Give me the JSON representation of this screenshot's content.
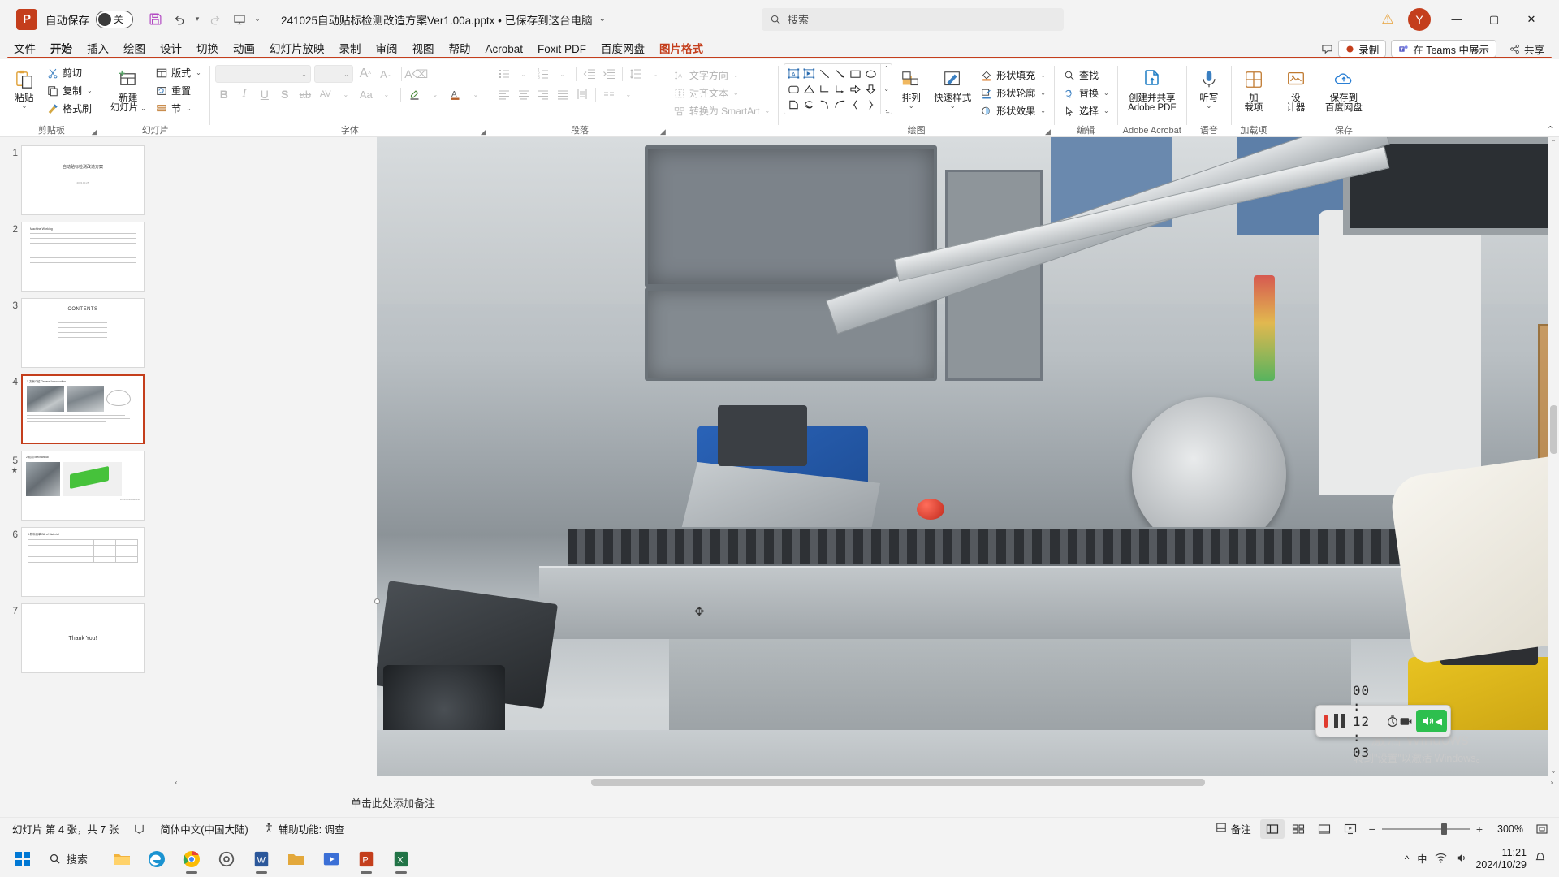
{
  "titlebar": {
    "app_badge": "P",
    "autosave_label": "自动保存",
    "autosave_state": "关",
    "save_icon": "save-icon",
    "undo_icon": "undo-icon",
    "redo_icon": "redo-icon",
    "present_icon": "start-presentation-icon",
    "customize_icon": "customize-quick-access-icon",
    "doc_title": "241025自动贴标检测改造方案Ver1.00a.pptx • 已保存到这台电脑",
    "search_placeholder": "搜索",
    "warning_icon": "warning-icon",
    "avatar_initial": "Y",
    "minimize": "—",
    "maximize": "▢",
    "close": "✕"
  },
  "tabs": [
    {
      "label": "文件",
      "state": "normal"
    },
    {
      "label": "开始",
      "state": "active"
    },
    {
      "label": "插入",
      "state": "normal"
    },
    {
      "label": "绘图",
      "state": "normal"
    },
    {
      "label": "设计",
      "state": "normal"
    },
    {
      "label": "切换",
      "state": "normal"
    },
    {
      "label": "动画",
      "state": "normal"
    },
    {
      "label": "幻灯片放映",
      "state": "normal"
    },
    {
      "label": "录制",
      "state": "normal"
    },
    {
      "label": "审阅",
      "state": "normal"
    },
    {
      "label": "视图",
      "state": "normal"
    },
    {
      "label": "帮助",
      "state": "normal"
    },
    {
      "label": "Acrobat",
      "state": "normal"
    },
    {
      "label": "Foxit PDF",
      "state": "normal"
    },
    {
      "label": "百度网盘",
      "state": "normal"
    },
    {
      "label": "图片格式",
      "state": "contextual"
    }
  ],
  "tabs_right": {
    "comment_icon": "comment-icon",
    "record_label": "录制",
    "record_icon": "record-dot-icon",
    "teams_label": "在 Teams 中展示",
    "teams_icon": "teams-icon",
    "share_label": "共享",
    "share_icon": "share-icon"
  },
  "ribbon": {
    "collapse_icon": "collapse-ribbon-icon",
    "groups": [
      {
        "name": "clipboard",
        "label": "剪贴板",
        "paste": {
          "label": "粘贴",
          "icon": "paste-icon"
        },
        "items": [
          {
            "label": "剪切",
            "icon": "scissors-icon"
          },
          {
            "label": "复制",
            "icon": "copy-icon"
          },
          {
            "label": "格式刷",
            "icon": "format-painter-icon"
          }
        ]
      },
      {
        "name": "slides",
        "label": "幻灯片",
        "newslide": {
          "label": "新建\n幻灯片",
          "icon": "new-slide-icon"
        },
        "items": [
          {
            "label": "版式",
            "icon": "layout-icon"
          },
          {
            "label": "重置",
            "icon": "reset-icon"
          },
          {
            "label": "节",
            "icon": "section-icon"
          }
        ]
      },
      {
        "name": "font",
        "label": "字体",
        "font_name": "",
        "font_size": "",
        "grow_icon": "grow-font-icon",
        "shrink_icon": "shrink-font-icon",
        "clear_format_icon": "clear-formatting-icon",
        "bold": "B",
        "italic": "I",
        "underline": "U",
        "shadow": "S",
        "strike_icon": "strikethrough-icon",
        "char_spacing_icon": "character-spacing-icon",
        "case_icon": "change-case-icon",
        "highlight_icon": "text-highlight-icon",
        "fontcolor_icon": "font-color-icon"
      },
      {
        "name": "paragraph",
        "label": "段落",
        "bullets_icon": "bullets-icon",
        "numbering_icon": "numbering-icon",
        "dec_indent_icon": "decrease-indent-icon",
        "inc_indent_icon": "increase-indent-icon",
        "line_spacing_icon": "line-spacing-icon",
        "align_left_icon": "align-left-icon",
        "align_center_icon": "align-center-icon",
        "align_right_icon": "align-right-icon",
        "justify_icon": "justify-icon",
        "columns_icon": "columns-icon",
        "text_dir_label": "文字方向",
        "text_dir_icon": "text-direction-icon",
        "align_text_label": "对齐文本",
        "align_text_icon": "align-text-icon",
        "smartart_label": "转换为 SmartArt",
        "smartart_icon": "smartart-icon"
      },
      {
        "name": "drawing",
        "label": "绘图",
        "shapes": [
          "textbox",
          "arrow-textbox",
          "line",
          "arrow",
          "rectangle",
          "oval",
          "rounded-rect",
          "triangle",
          "elbow-connector",
          "elbow-arrow",
          "block-arrow",
          "down-arrow",
          "flowchart-shape",
          "scribble",
          "curve",
          "arc",
          "left-brace",
          "right-brace"
        ],
        "arrange_label": "排列",
        "arrange_icon": "arrange-icon",
        "quickstyle_label": "快速样式",
        "quickstyle_icon": "quick-styles-icon",
        "items": [
          {
            "label": "形状填充",
            "icon": "shape-fill-icon"
          },
          {
            "label": "形状轮廓",
            "icon": "shape-outline-icon"
          },
          {
            "label": "形状效果",
            "icon": "shape-effects-icon"
          }
        ]
      },
      {
        "name": "editing",
        "label": "编辑",
        "items": [
          {
            "label": "查找",
            "icon": "search-icon"
          },
          {
            "label": "替换",
            "icon": "replace-icon"
          },
          {
            "label": "选择",
            "icon": "select-icon"
          }
        ]
      },
      {
        "name": "adobe",
        "label": "Adobe Acrobat",
        "button": {
          "label": "创建并共享\nAdobe PDF",
          "icon": "adobe-pdf-icon"
        }
      },
      {
        "name": "voice",
        "label": "语音",
        "button": {
          "label": "听写",
          "icon": "microphone-icon"
        }
      },
      {
        "name": "addins",
        "label": "加载项",
        "button": {
          "label": "加\n载项",
          "icon": "addins-icon"
        }
      },
      {
        "name": "designer",
        "label": "",
        "button": {
          "label": "设\n计器",
          "icon": "designer-icon"
        }
      },
      {
        "name": "save",
        "label": "保存",
        "button": {
          "label": "保存到\n百度网盘",
          "icon": "baidu-netdisk-icon"
        }
      }
    ]
  },
  "thumbnails": [
    {
      "num": "1",
      "title": "自动贴标检测改造方案",
      "selected": false,
      "star": false
    },
    {
      "num": "2",
      "title": "Machine Working",
      "selected": false,
      "star": false
    },
    {
      "num": "3",
      "title": "CONTENTS",
      "selected": false,
      "star": false
    },
    {
      "num": "4",
      "title": "1.方案介绍 General Introduction",
      "selected": true,
      "star": false
    },
    {
      "num": "5",
      "title": "2.机构 Mechanical",
      "selected": false,
      "star": true
    },
    {
      "num": "6",
      "title": "3.物料清单 Bill of Material",
      "selected": false,
      "star": false
    },
    {
      "num": "7",
      "title": "Thank You!",
      "selected": false,
      "star": false
    }
  ],
  "slide": {
    "notes_placeholder": "单击此处添加备注",
    "watermark_line1": "激活 Windows",
    "watermark_line2": "转到\"设置\"以激活 Windows。"
  },
  "recorder": {
    "stop_icon": "stop-recording-icon",
    "pause_icon": "pause-recording-icon",
    "time": "00 : 12 : 03",
    "timer_icon": "timer-icon",
    "camera_icon": "camera-icon",
    "speaker_icon": "speaker-icon"
  },
  "statusbar": {
    "slide_count": "幻灯片 第 4 张，共 7 张",
    "accessibility_icon": "accessibility-icon",
    "language": "简体中文(中国大陆)",
    "accessibility_label": "辅助功能: 调查",
    "notes_label": "备注",
    "notes_icon": "notes-icon",
    "view_normal_icon": "normal-view-icon",
    "view_sorter_icon": "slide-sorter-icon",
    "view_reading_icon": "reading-view-icon",
    "view_show_icon": "slide-show-icon",
    "zoom_out_icon": "zoom-out-icon",
    "zoom_in_icon": "zoom-in-icon",
    "zoom_level": "300%",
    "fit_icon": "fit-to-window-icon"
  },
  "taskbar": {
    "start_icon": "windows-start-icon",
    "search_label": "搜索",
    "search_icon": "search-icon",
    "apps": [
      {
        "name": "file-explorer-icon",
        "running": false
      },
      {
        "name": "edge-icon",
        "running": false
      },
      {
        "name": "chrome-icon",
        "running": true
      },
      {
        "name": "settings-icon",
        "running": false
      },
      {
        "name": "word-icon",
        "running": true
      },
      {
        "name": "folder-icon",
        "running": false
      },
      {
        "name": "media-player-icon",
        "running": false
      },
      {
        "name": "powerpoint-icon",
        "running": true
      },
      {
        "name": "excel-icon",
        "running": true
      }
    ],
    "tray_chevron": "^",
    "ime_label": "中",
    "time": "11:21",
    "date": "2024/10/29"
  },
  "colors": {
    "accent": "#c43e1c",
    "ribbon_bg": "#ffffff",
    "chrome_bg": "#f3f3f3",
    "selection": "#c43e1c",
    "record_red": "#e03b2f",
    "green": "#2dbf4e"
  }
}
